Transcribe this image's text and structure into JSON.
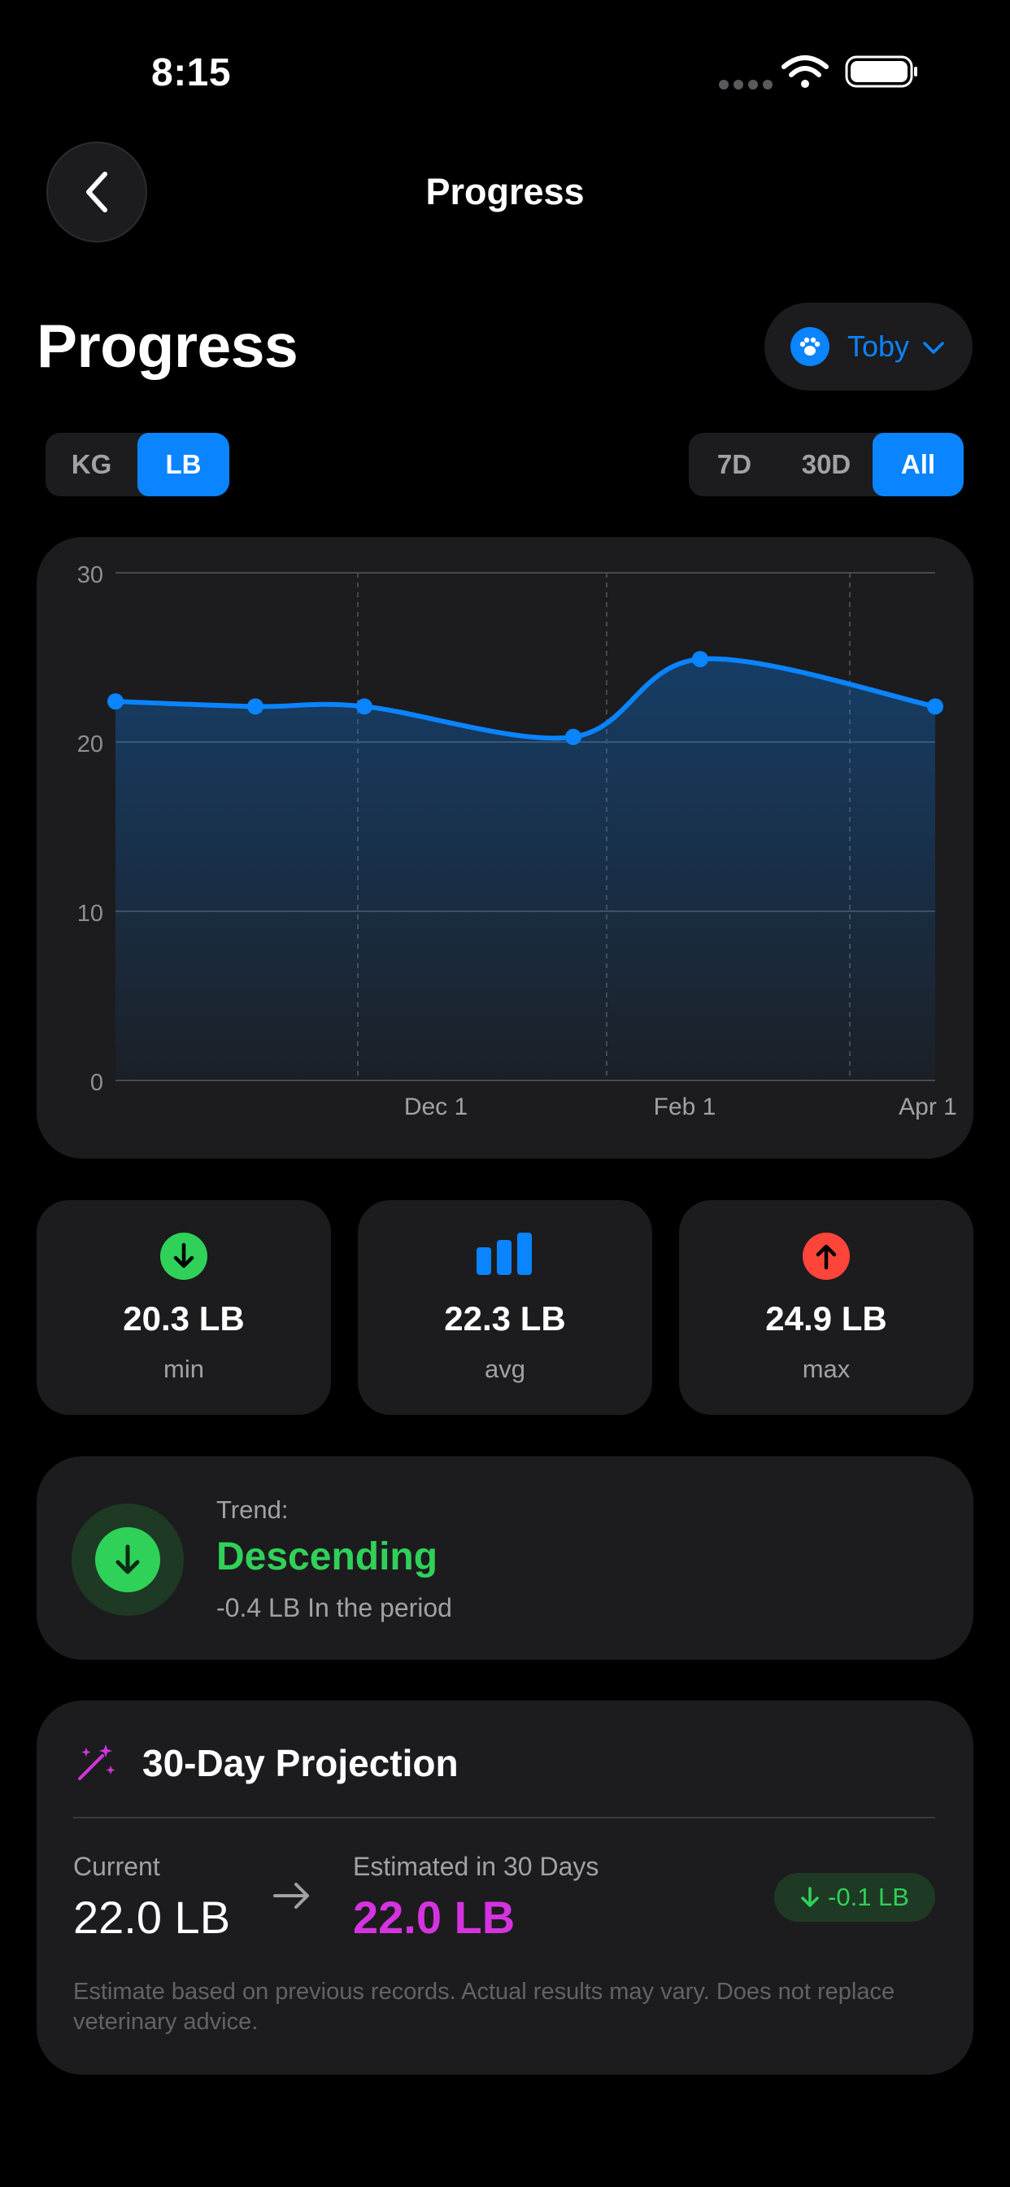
{
  "status_bar": {
    "time": "8:15"
  },
  "nav": {
    "title": "Progress",
    "back_icon": "chevron-left-icon"
  },
  "header": {
    "title": "Progress"
  },
  "pet_selector": {
    "name": "Toby",
    "icon": "paw-icon"
  },
  "unit_toggle": {
    "options": [
      "KG",
      "LB"
    ],
    "selected": "LB"
  },
  "range_toggle": {
    "options": [
      "7D",
      "30D",
      "All"
    ],
    "selected": "All"
  },
  "chart_data": {
    "type": "area",
    "x_tick_labels": [
      "Dec 1",
      "Feb 1",
      "Apr 1"
    ],
    "y_ticks": [
      0,
      10,
      20,
      30
    ],
    "ylim": [
      0,
      30
    ],
    "points": [
      22.4,
      22.1,
      22.1,
      20.3,
      24.9,
      22.1
    ],
    "colors": {
      "line": "#0a84ff"
    }
  },
  "stats": [
    {
      "value": "20.3 LB",
      "label": "min",
      "icon": "arrow-down-circle-icon",
      "color": "#30d158"
    },
    {
      "value": "22.3 LB",
      "label": "avg",
      "icon": "bar-chart-icon",
      "color": "#0a84ff"
    },
    {
      "value": "24.9 LB",
      "label": "max",
      "icon": "arrow-up-circle-icon",
      "color": "#ff453a"
    }
  ],
  "trend": {
    "label": "Trend:",
    "value": "Descending",
    "sub": "-0.4 LB In the period"
  },
  "projection": {
    "title": "30-Day Projection",
    "current_label": "Current",
    "current_value": "22.0 LB",
    "estimated_label": "Estimated in 30 Days",
    "estimated_value": "22.0 LB",
    "delta": "-0.1 LB",
    "disclaimer": "Estimate based on previous records. Actual results may vary. Does not replace veterinary advice."
  }
}
